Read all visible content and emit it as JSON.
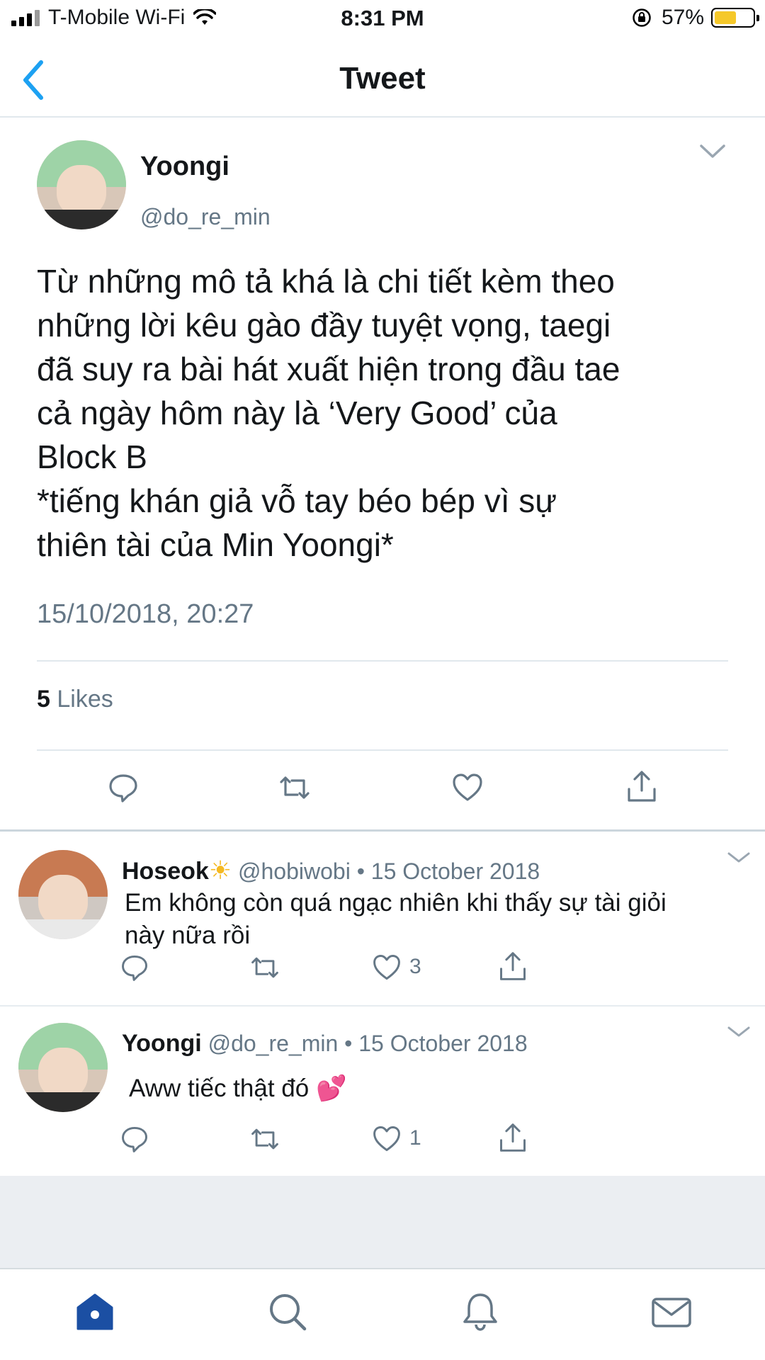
{
  "status_bar": {
    "carrier": "T-Mobile Wi-Fi",
    "time": "8:31 PM",
    "battery": "57%",
    "battery_level": 0.57
  },
  "header": {
    "title": "Tweet"
  },
  "tweet": {
    "author_name": "Yoongi",
    "author_handle": "@do_re_min",
    "text": "Từ những mô tả khá là chi tiết kèm theo\nnhững lời kêu gào đầy tuyệt vọng, taegi\nđã suy ra bài hát xuất hiện trong đầu tae\ncả ngày hôm này là ‘Very Good’ của\nBlock B\n*tiếng khán giả vỗ tay béo bép vì sự\nthiên tài của Min Yoongi*",
    "timestamp": "15/10/2018, 20:27",
    "likes_count": "5",
    "likes_label": "Likes"
  },
  "replies": [
    {
      "name": "Hoseok",
      "emoji": "☀",
      "handle": "@hobiwobi",
      "separator": "•",
      "date": "15 October 2018",
      "text": "Em không còn quá ngạc nhiên khi thấy sự tài giỏi này nữa rồi",
      "like_count": "3"
    },
    {
      "name": "Yoongi",
      "emoji": "",
      "handle": "@do_re_min",
      "separator": "•",
      "date": "15 October 2018",
      "text": "Aww tiếc thật đó",
      "text_emoji": "💕",
      "like_count": "1"
    }
  ],
  "icons": {
    "back": "chevron-left-icon",
    "reply": "reply-icon",
    "retweet": "retweet-icon",
    "like": "heart-icon",
    "share": "share-icon",
    "home": "home-icon",
    "search": "search-icon",
    "notifications": "bell-icon",
    "messages": "mail-icon"
  },
  "colors": {
    "accent": "#1da1f2",
    "tab_active": "#1b4fa3",
    "icon_gray": "#657786",
    "divider": "#e1e8ed"
  }
}
